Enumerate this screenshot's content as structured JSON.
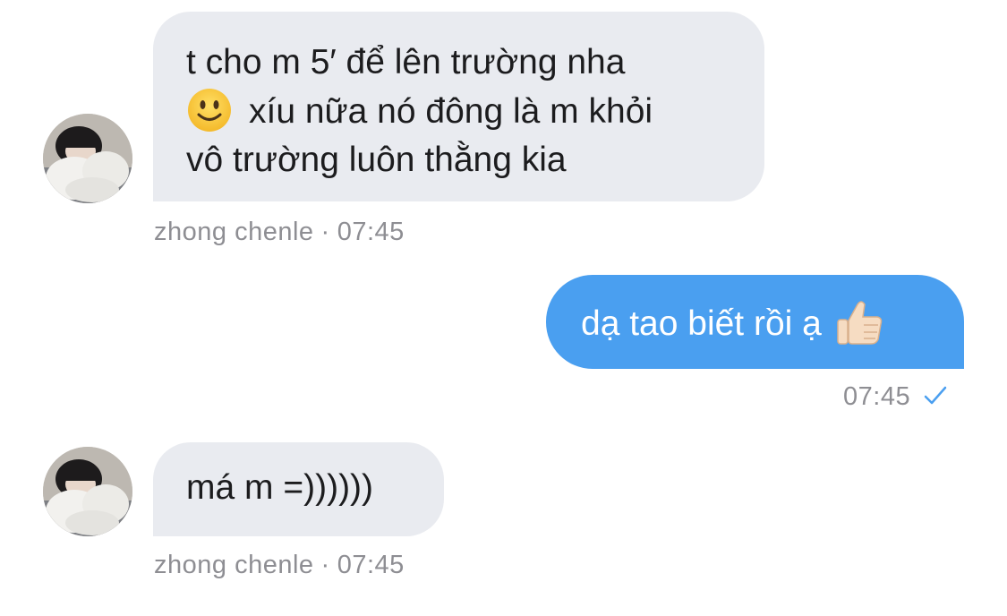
{
  "colors": {
    "incoming_bubble": "#e9ebf0",
    "outgoing_bubble": "#4a9ff0",
    "meta_text": "#8e8e93",
    "check": "#4a9ff0"
  },
  "messages": [
    {
      "direction": "incoming",
      "avatar_icon": "profile-photo",
      "lines": [
        "t cho m 5′ để lên trường nha",
        "xíu nữa nó đông là m khỏi",
        "vô trường luôn thằng kia"
      ],
      "emoji_icon": "slightly-smiling-face-emoji",
      "sender": "zhong chenle",
      "separator": "·",
      "time": "07:45"
    },
    {
      "direction": "outgoing",
      "text": "dạ tao biết rồi ạ",
      "emoji_icon": "thumbs-up-emoji",
      "time": "07:45",
      "status_icon": "check-icon"
    },
    {
      "direction": "incoming",
      "avatar_icon": "profile-photo",
      "text": "má m =))))))",
      "sender": "zhong chenle",
      "separator": "·",
      "time": "07:45"
    }
  ]
}
